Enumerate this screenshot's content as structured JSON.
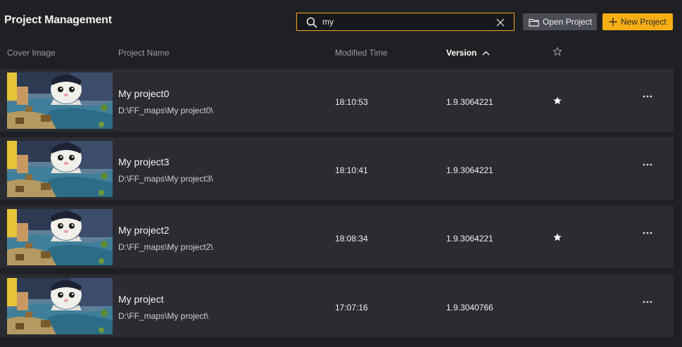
{
  "header": {
    "title": "Project Management",
    "search": {
      "value": "my",
      "icon": "search-icon",
      "clear_icon": "close-icon"
    },
    "open_project_label": "Open Project",
    "new_project_label": "New Project",
    "accent_color": "#f5ae14"
  },
  "columns": {
    "cover": "Cover Image",
    "name": "Project Name",
    "modified": "Modified Time",
    "version": "Version",
    "version_sort": "ascending",
    "favorite_icon": "star-outline-icon"
  },
  "projects": [
    {
      "name": "My project0",
      "path": "D:\\FF_maps\\My project0\\",
      "time": "18:10:53",
      "version": "1.9.3064221",
      "favorite": true
    },
    {
      "name": "My project3",
      "path": "D:\\FF_maps\\My project3\\",
      "time": "18:10:41",
      "version": "1.9.3064221",
      "favorite": false
    },
    {
      "name": "My project2",
      "path": "D:\\FF_maps\\My project2\\",
      "time": "18:08:34",
      "version": "1.9.3064221",
      "favorite": true
    },
    {
      "name": "My project",
      "path": "D:\\FF_maps\\My project\\",
      "time": "17:07:16",
      "version": "1.9.3040766",
      "favorite": false
    }
  ]
}
